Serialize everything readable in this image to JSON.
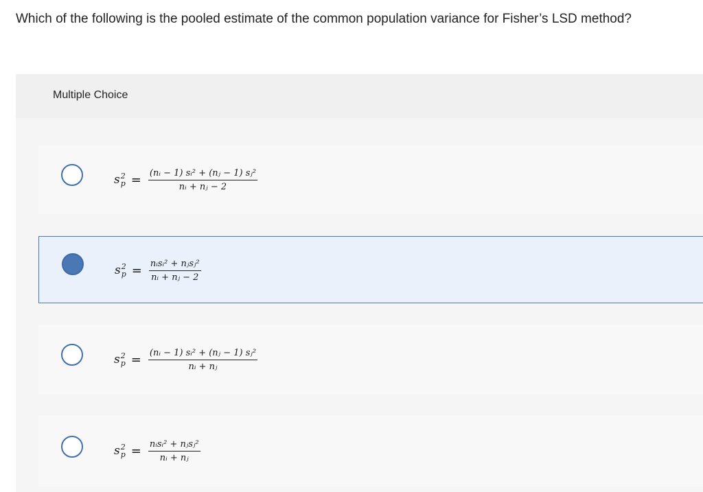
{
  "question": {
    "text": "Which of the following is the pooled estimate of the common population variance for Fisher’s LSD method?"
  },
  "panel": {
    "title": "Multiple Choice"
  },
  "options": [
    {
      "lhs_base": "s",
      "lhs_sup": "2",
      "lhs_sub": "p",
      "equals": "=",
      "numerator": "(nᵢ − 1) sᵢ² + (nⱼ − 1) sⱼ²",
      "denominator": "nᵢ + nⱼ − 2",
      "selected": false
    },
    {
      "lhs_base": "s",
      "lhs_sup": "2",
      "lhs_sub": "p",
      "equals": "=",
      "numerator": "nᵢsᵢ² + nⱼsⱼ²",
      "denominator": "nᵢ + nⱼ − 2",
      "selected": true
    },
    {
      "lhs_base": "s",
      "lhs_sup": "2",
      "lhs_sub": "p",
      "equals": "=",
      "numerator": "(nᵢ − 1) sᵢ² + (nⱼ − 1) sⱼ²",
      "denominator": "nᵢ + nⱼ",
      "selected": false
    },
    {
      "lhs_base": "s",
      "lhs_sup": "2",
      "lhs_sub": "p",
      "equals": "=",
      "numerator": "nᵢsᵢ² + nⱼsⱼ²",
      "denominator": "nᵢ + nⱼ",
      "selected": false
    }
  ],
  "colors": {
    "accent": "#4a78b5",
    "selected_bg": "#eaf1fb"
  }
}
